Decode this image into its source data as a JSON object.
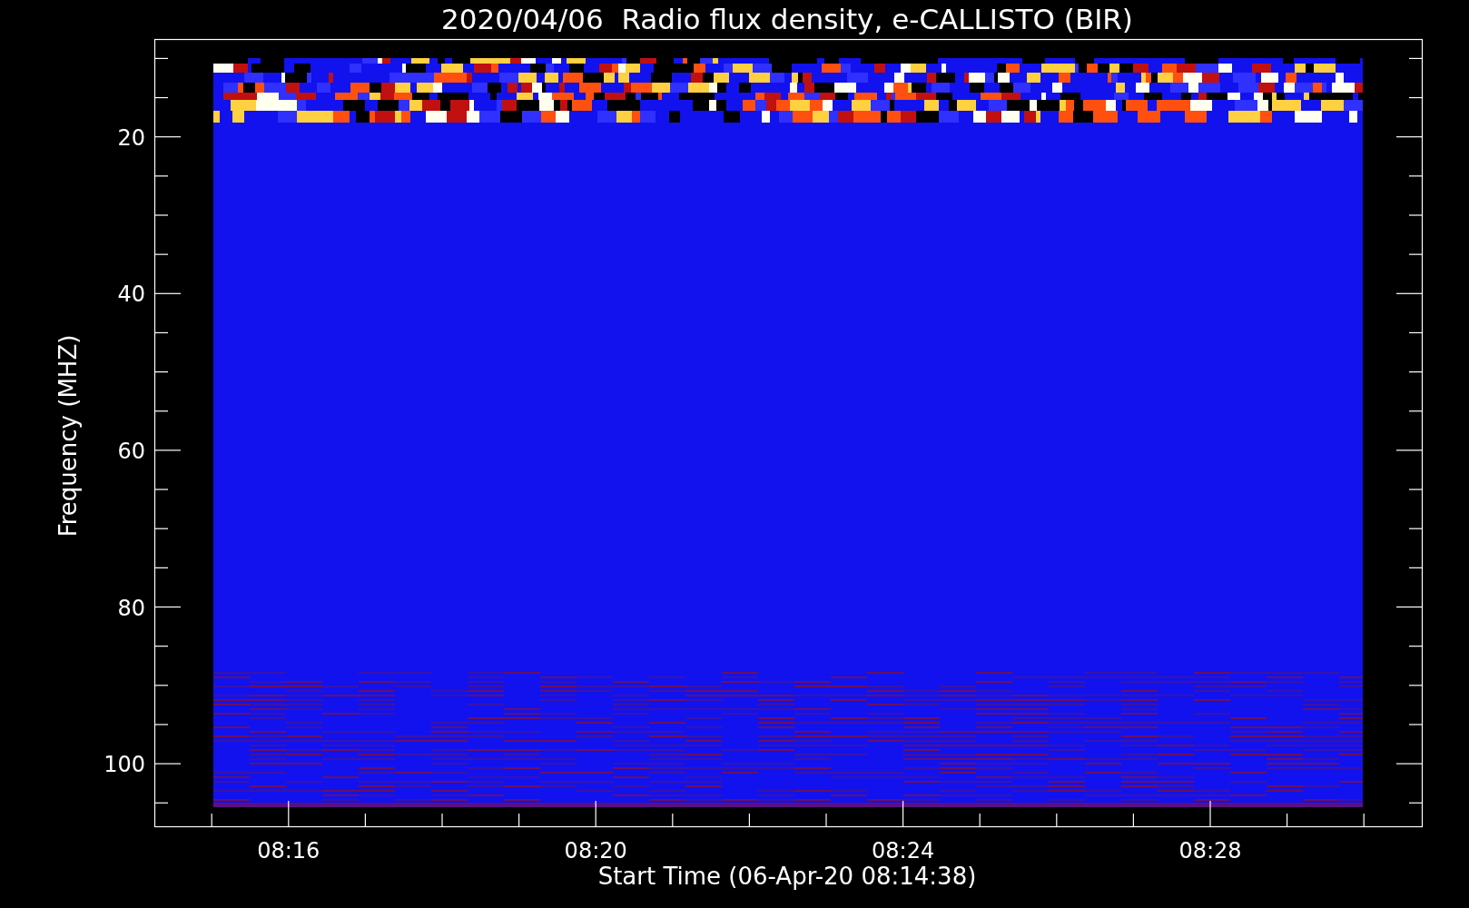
{
  "title": "2020/04/06  Radio flux density, e-CALLISTO (BIR)",
  "y_axis": {
    "label": "Frequency (MHZ)",
    "tick_labels": [
      "20",
      "40",
      "60",
      "80",
      "100"
    ]
  },
  "x_axis": {
    "label": "Start Time (06-Apr-20 08:14:38)",
    "tick_labels": [
      "08:16",
      "08:20",
      "08:24",
      "08:28"
    ]
  }
}
